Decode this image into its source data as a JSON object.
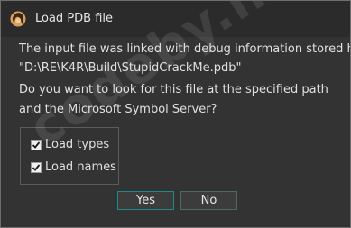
{
  "window": {
    "title": "Load PDB file",
    "icon": "ida-app-icon"
  },
  "message": {
    "lines": [
      "The input file was linked with debug information stored here:",
      "\"D:\\RE\\K4R\\Build\\StupidCrackMe.pdb\"",
      "Do you want to look for this file at the specified path",
      "and the Microsoft Symbol Server?"
    ]
  },
  "options": {
    "items": [
      {
        "label": "Load types",
        "checked": true
      },
      {
        "label": "Load names",
        "checked": true
      }
    ]
  },
  "buttons": {
    "yes_label": "Yes",
    "no_label": "No"
  },
  "watermark": "codeby.net",
  "colors": {
    "background": "#333333",
    "titlebar": "#2b2b2b",
    "text": "#e0e0e0",
    "button_border": "#1f8a8a"
  }
}
